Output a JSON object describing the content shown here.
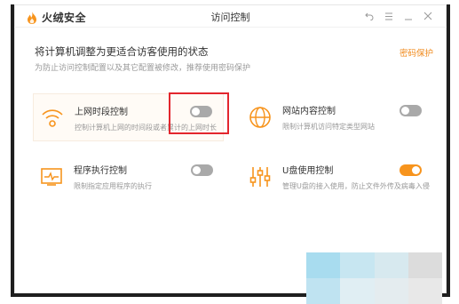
{
  "titlebar": {
    "app_name": "火绒安全",
    "window_title": "访问控制",
    "controls": [
      {
        "name": "back-icon",
        "glyph": "↶"
      },
      {
        "name": "menu-icon",
        "glyph": "☰"
      },
      {
        "name": "minimize-icon",
        "glyph": "_"
      },
      {
        "name": "close-icon",
        "glyph": "✕"
      }
    ]
  },
  "header": {
    "title": "将计算机调整为更适合访客使用的状态",
    "subtitle": "为防止访问控制配置以及其它配置被修改，推荐使用密码保护",
    "password_link": "密码保护"
  },
  "cards": [
    {
      "title": "上网时段控制",
      "desc": "控制计算机上网的时间段或者累计的上网时长",
      "icon": "wifi-icon",
      "enabled": false
    },
    {
      "title": "网站内容控制",
      "desc": "限制计算机访问特定类型网站",
      "icon": "globe-icon",
      "enabled": false
    },
    {
      "title": "程序执行控制",
      "desc": "限制指定应用程序的执行",
      "icon": "program-monitor-icon",
      "enabled": false
    },
    {
      "title": "U盘使用控制",
      "desc": "管理U盘的接入使用，防止文件外传及病毒入侵",
      "icon": "usb-sliders-icon",
      "enabled": true
    }
  ],
  "colors": {
    "accent": "#f7941d",
    "toggle_off": "#a9a9a9",
    "highlight": "#e3262d",
    "link": "#f08a1c"
  }
}
